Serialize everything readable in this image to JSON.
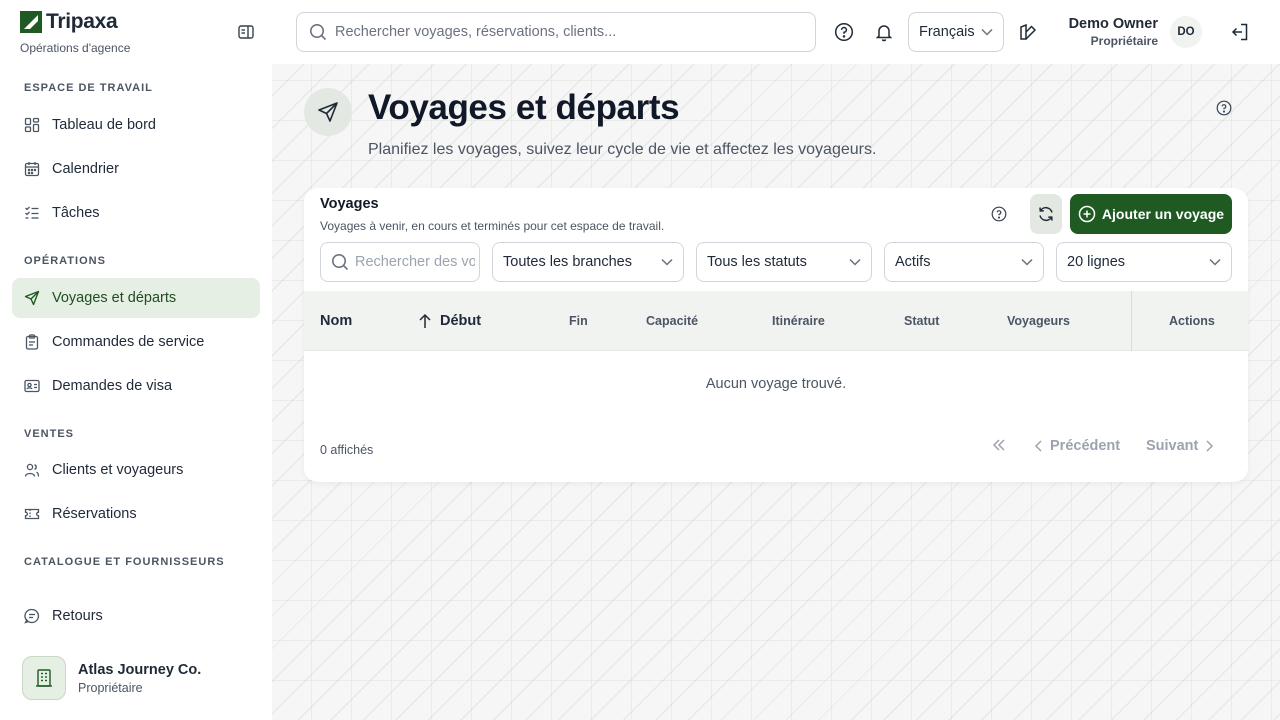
{
  "app": {
    "name": "Tripaxa",
    "subtitle": "Opérations d'agence",
    "brand_color": "#1f5a23",
    "icons": {
      "logo": "tripaxa-logo-icon",
      "collapse": "sidebar-collapse-icon"
    }
  },
  "sidebar": {
    "sections": [
      {
        "title": "ESPACE DE TRAVAIL"
      },
      {
        "title": "OPÉRATIONS"
      },
      {
        "title": "VENTES"
      },
      {
        "title": "CATALOGUE ET FOURNISSEURS"
      }
    ],
    "items": [
      {
        "label": "Tableau de bord",
        "icon": "dashboard-icon"
      },
      {
        "label": "Calendrier",
        "icon": "calendar-icon"
      },
      {
        "label": "Tâches",
        "icon": "tasks-icon"
      },
      {
        "label": "Voyages et départs",
        "icon": "send-icon",
        "active": true
      },
      {
        "label": "Commandes de service",
        "icon": "clipboard-icon"
      },
      {
        "label": "Demandes de visa",
        "icon": "id-card-icon"
      },
      {
        "label": "Clients et voyageurs",
        "icon": "users-icon"
      },
      {
        "label": "Réservations",
        "icon": "ticket-icon"
      },
      {
        "label": "Retours",
        "icon": "feedback-icon"
      }
    ],
    "org": {
      "name": "Atlas Journey Co.",
      "role": "Propriétaire",
      "icon": "building-icon"
    }
  },
  "topbar": {
    "search_placeholder": "Rechercher voyages, réservations, clients...",
    "language": "Français",
    "icons": [
      "search-icon",
      "help-icon",
      "bell-icon",
      "theme-icon",
      "logout-icon"
    ],
    "user": {
      "name": "Demo Owner",
      "role": "Propriétaire",
      "initials": "DO"
    }
  },
  "page": {
    "title": "Voyages et départs",
    "subtitle": "Planifiez les voyages, suivez leur cycle de vie et affectez les voyageurs."
  },
  "card": {
    "title": "Voyages",
    "description": "Voyages à venir, en cours et terminés pour cet espace de travail.",
    "add_label": "Ajouter un voyage",
    "filters": {
      "search_placeholder": "Rechercher des voyages",
      "branch": "Toutes les branches",
      "status": "Tous les statuts",
      "activity": "Actifs",
      "rows": "20 lignes"
    },
    "columns": [
      "Nom",
      "Début",
      "Fin",
      "Capacité",
      "Itinéraire",
      "Statut",
      "Voyageurs",
      "Actions"
    ],
    "sort": {
      "column": "Début",
      "direction": "ascending"
    },
    "rows": [],
    "empty_text": "Aucun voyage trouvé.",
    "count_text": "0 affichés",
    "pagination": {
      "previous": "Précédent",
      "next": "Suivant"
    }
  }
}
